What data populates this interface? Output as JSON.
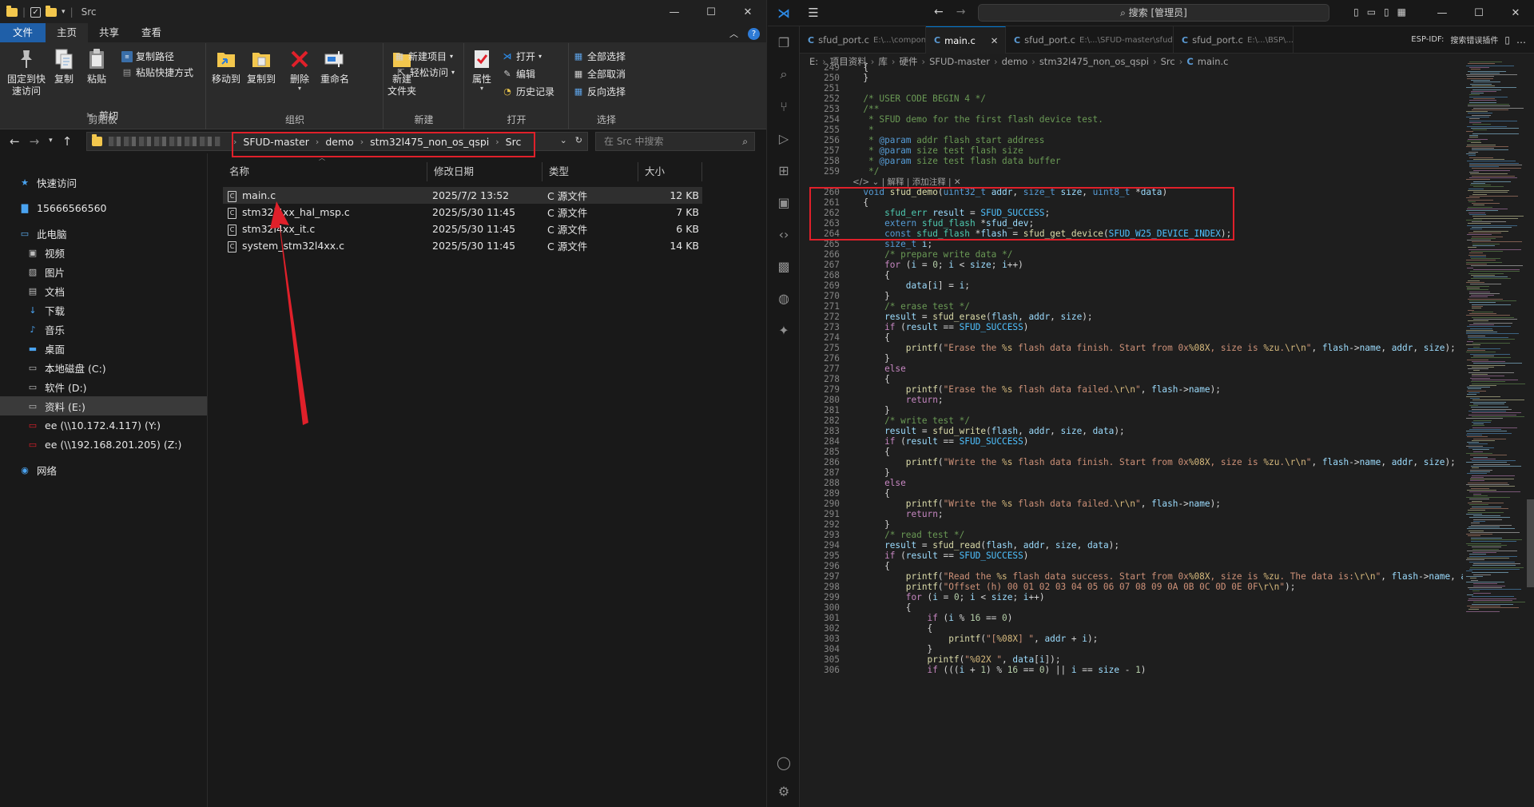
{
  "explorer": {
    "window_title": "Src",
    "ribbon_tabs": [
      "文件",
      "主页",
      "共享",
      "查看"
    ],
    "ribbon": {
      "clipboard": {
        "label": "剪贴板",
        "pin": "固定到快\n速访问",
        "copy": "复制",
        "paste": "粘贴",
        "copy_path": "复制路径",
        "paste_shortcut": "粘贴快捷方式",
        "cut": "剪切"
      },
      "organize": {
        "label": "组织",
        "move_to": "移动到",
        "copy_to": "复制到",
        "delete": "删除",
        "rename": "重命名"
      },
      "new": {
        "label": "新建",
        "new_folder": "新建\n文件夹",
        "new_item": "新建项目",
        "easy_access": "轻松访问"
      },
      "open": {
        "label": "打开",
        "properties": "属性",
        "open": "打开",
        "edit": "编辑",
        "history": "历史记录"
      },
      "select": {
        "label": "选择",
        "select_all": "全部选择",
        "select_none": "全部取消",
        "invert": "反向选择"
      }
    },
    "address": {
      "crumbs": [
        "SFUD-master",
        "demo",
        "stm32l475_non_os_qspi",
        "Src"
      ]
    },
    "search_placeholder": "在 Src 中搜索",
    "nav": {
      "quick_access": "快速访问",
      "user": "15666566560",
      "this_pc": "此电脑",
      "video": "视频",
      "pictures": "图片",
      "documents": "文档",
      "downloads": "下载",
      "music": "音乐",
      "desktop": "桌面",
      "drive_c": "本地磁盘 (C:)",
      "drive_d": "软件 (D:)",
      "drive_e": "资料 (E:)",
      "net_y": "ee (\\\\10.172.4.117) (Y:)",
      "net_z": "ee (\\\\192.168.201.205) (Z:)",
      "network": "网络"
    },
    "columns": {
      "name": "名称",
      "modified": "修改日期",
      "type": "类型",
      "size": "大小"
    },
    "files": [
      {
        "name": "main.c",
        "modified": "2025/7/2 13:52",
        "type": "C 源文件",
        "size": "12 KB"
      },
      {
        "name": "stm32l4xx_hal_msp.c",
        "modified": "2025/5/30 11:45",
        "type": "C 源文件",
        "size": "7 KB"
      },
      {
        "name": "stm32l4xx_it.c",
        "modified": "2025/5/30 11:45",
        "type": "C 源文件",
        "size": "6 KB"
      },
      {
        "name": "system_stm32l4xx.c",
        "modified": "2025/5/30 11:45",
        "type": "C 源文件",
        "size": "14 KB"
      }
    ]
  },
  "vscode": {
    "command_center": "搜索 [管理员]",
    "tabs": [
      {
        "name": "sfud_port.c",
        "path": "E:\\...\\components\\..."
      },
      {
        "name": "main.c",
        "path": "",
        "close": "✕"
      },
      {
        "name": "sfud_port.c",
        "path": "E:\\...\\SFUD-master\\sfud\\..."
      },
      {
        "name": "sfud_port.c",
        "path": "E:\\...\\BSP\\..."
      }
    ],
    "tabs_tail": "ESP-IDF:",
    "tabs_tail2": "搜索错误插件",
    "breadcrumb": [
      "E:",
      "项目资料",
      "库",
      "硬件",
      "SFUD-master",
      "demo",
      "stm32l475_non_os_qspi",
      "Src",
      "main.c"
    ],
    "codelens": "解释 | 添加注释 | ✕",
    "code_lines": [
      {
        "n": "249",
        "t": "  {"
      },
      {
        "n": "250",
        "t": "  }"
      },
      {
        "n": "251",
        "t": ""
      },
      {
        "n": "252",
        "t": "  /* USER CODE BEGIN 4 */"
      },
      {
        "n": "253",
        "t": "  /**"
      },
      {
        "n": "254",
        "t": "   * SFUD demo for the first flash device test."
      },
      {
        "n": "255",
        "t": "   *"
      },
      {
        "n": "256",
        "t": "   * @param addr flash start address"
      },
      {
        "n": "257",
        "t": "   * @param size test flash size"
      },
      {
        "n": "258",
        "t": "   * @param size test flash data buffer"
      },
      {
        "n": "259",
        "t": "   */"
      },
      {
        "n": "260",
        "t": "  void sfud_demo(uint32_t addr, size_t size, uint8_t *data)"
      },
      {
        "n": "261",
        "t": "  {"
      },
      {
        "n": "262",
        "t": "      sfud_err result = SFUD_SUCCESS;"
      },
      {
        "n": "263",
        "t": "      extern sfud_flash *sfud_dev;"
      },
      {
        "n": "264",
        "t": "      const sfud_flash *flash = sfud_get_device(SFUD_W25_DEVICE_INDEX);"
      },
      {
        "n": "265",
        "t": "      size_t i;"
      },
      {
        "n": "266",
        "t": "      /* prepare write data */"
      },
      {
        "n": "267",
        "t": "      for (i = 0; i < size; i++)"
      },
      {
        "n": "268",
        "t": "      {"
      },
      {
        "n": "269",
        "t": "          data[i] = i;"
      },
      {
        "n": "270",
        "t": "      }"
      },
      {
        "n": "271",
        "t": "      /* erase test */"
      },
      {
        "n": "272",
        "t": "      result = sfud_erase(flash, addr, size);"
      },
      {
        "n": "273",
        "t": "      if (result == SFUD_SUCCESS)"
      },
      {
        "n": "274",
        "t": "      {"
      },
      {
        "n": "275",
        "t": "          printf(\"Erase the %s flash data finish. Start from 0x%08X, size is %zu.\\r\\n\", flash->name, addr, size);"
      },
      {
        "n": "276",
        "t": "      }"
      },
      {
        "n": "277",
        "t": "      else"
      },
      {
        "n": "278",
        "t": "      {"
      },
      {
        "n": "279",
        "t": "          printf(\"Erase the %s flash data failed.\\r\\n\", flash->name);"
      },
      {
        "n": "280",
        "t": "          return;"
      },
      {
        "n": "281",
        "t": "      }"
      },
      {
        "n": "282",
        "t": "      /* write test */"
      },
      {
        "n": "283",
        "t": "      result = sfud_write(flash, addr, size, data);"
      },
      {
        "n": "284",
        "t": "      if (result == SFUD_SUCCESS)"
      },
      {
        "n": "285",
        "t": "      {"
      },
      {
        "n": "286",
        "t": "          printf(\"Write the %s flash data finish. Start from 0x%08X, size is %zu.\\r\\n\", flash->name, addr, size);"
      },
      {
        "n": "287",
        "t": "      }"
      },
      {
        "n": "288",
        "t": "      else"
      },
      {
        "n": "289",
        "t": "      {"
      },
      {
        "n": "290",
        "t": "          printf(\"Write the %s flash data failed.\\r\\n\", flash->name);"
      },
      {
        "n": "291",
        "t": "          return;"
      },
      {
        "n": "292",
        "t": "      }"
      },
      {
        "n": "293",
        "t": "      /* read test */"
      },
      {
        "n": "294",
        "t": "      result = sfud_read(flash, addr, size, data);"
      },
      {
        "n": "295",
        "t": "      if (result == SFUD_SUCCESS)"
      },
      {
        "n": "296",
        "t": "      {"
      },
      {
        "n": "297",
        "t": "          printf(\"Read the %s flash data success. Start from 0x%08X, size is %zu. The data is:\\r\\n\", flash->name, ad"
      },
      {
        "n": "298",
        "t": "          printf(\"Offset (h) 00 01 02 03 04 05 06 07 08 09 0A 0B 0C 0D 0E 0F\\r\\n\");"
      },
      {
        "n": "299",
        "t": "          for (i = 0; i < size; i++)"
      },
      {
        "n": "300",
        "t": "          {"
      },
      {
        "n": "301",
        "t": "              if (i % 16 == 0)"
      },
      {
        "n": "302",
        "t": "              {"
      },
      {
        "n": "303",
        "t": "                  printf(\"[%08X] \", addr + i);"
      },
      {
        "n": "304",
        "t": "              }"
      },
      {
        "n": "305",
        "t": "              printf(\"%02X \", data[i]);"
      },
      {
        "n": "306",
        "t": "              if (((i + 1) % 16 == 0) || i == size - 1)"
      }
    ]
  },
  "colors": {
    "annotation_red": "#e0202a",
    "file_tab": "#1f5fa8",
    "folder": "#f3c74d",
    "vs_blue": "#0078d4"
  }
}
